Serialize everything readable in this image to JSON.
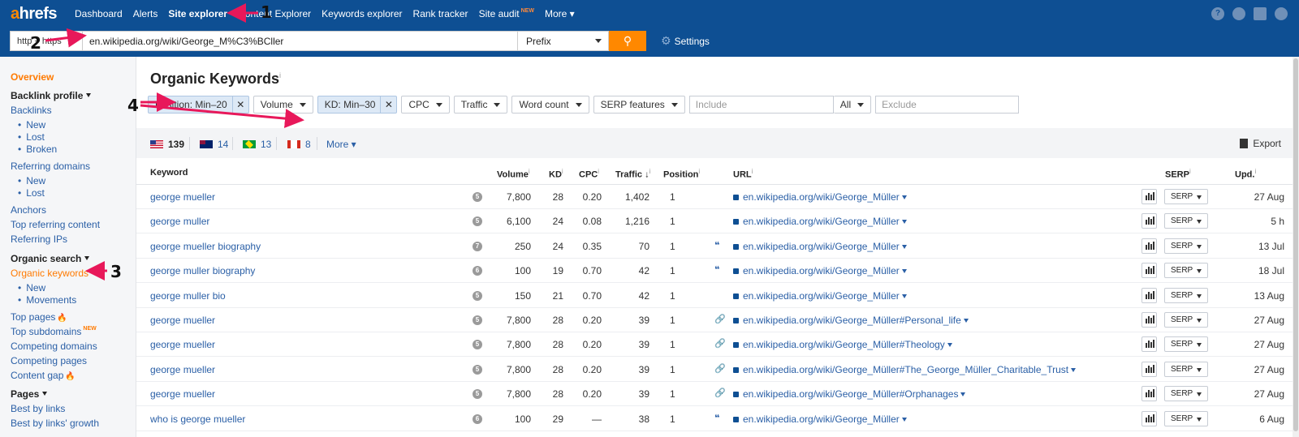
{
  "app": {
    "logo_a": "a",
    "logo_rest": "hrefs"
  },
  "nav": [
    {
      "label": "Dashboard",
      "active": false
    },
    {
      "label": "Alerts",
      "active": false
    },
    {
      "label": "Site explorer",
      "active": true
    },
    {
      "label": "Content Explorer",
      "active": false
    },
    {
      "label": "Keywords explorer",
      "active": false
    },
    {
      "label": "Rank tracker",
      "active": false
    },
    {
      "label": "Site audit",
      "active": false,
      "badge": "NEW"
    },
    {
      "label": "More",
      "active": false
    }
  ],
  "nav_display": [
    "Dashboard",
    "Alerts",
    "Site explorer",
    "Content Explorer",
    "Keywords explorer",
    "Rank tracker",
    "Site audit",
    "More"
  ],
  "search": {
    "protocol": "http + https",
    "url": "en.wikipedia.org/wiki/George_M%C3%BCller",
    "mode": "Prefix",
    "settings_label": "Settings"
  },
  "sidebar": {
    "overview": "Overview",
    "backlink_profile": "Backlink profile",
    "backlinks": "Backlinks",
    "backlinks_new": "New",
    "backlinks_lost": "Lost",
    "backlinks_broken": "Broken",
    "referring_domains": "Referring domains",
    "rd_new": "New",
    "rd_lost": "Lost",
    "anchors": "Anchors",
    "top_referring_content": "Top referring content",
    "referring_ips": "Referring IPs",
    "organic_search": "Organic search",
    "organic_keywords": "Organic keywords",
    "ok_new": "New",
    "ok_movements": "Movements",
    "top_pages": "Top pages",
    "top_subdomains": "Top subdomains",
    "top_subdomains_badge": "NEW",
    "competing_domains": "Competing domains",
    "competing_pages": "Competing pages",
    "content_gap": "Content gap",
    "pages": "Pages",
    "best_by_links": "Best by links",
    "best_by_links_growth": "Best by links' growth"
  },
  "main": {
    "title": "Organic Keywords",
    "title_info": "i",
    "filters": {
      "position": "Position: Min–20",
      "volume": "Volume",
      "kd": "KD: Min–30",
      "cpc": "CPC",
      "traffic": "Traffic",
      "word_count": "Word count",
      "serp_features": "SERP features",
      "include_placeholder": "Include",
      "all": "All",
      "exclude_placeholder": "Exclude"
    },
    "countries": [
      {
        "code": "us",
        "count": "139"
      },
      {
        "code": "au",
        "count": "14"
      },
      {
        "code": "br",
        "count": "13"
      },
      {
        "code": "ca",
        "count": "8"
      }
    ],
    "more_label": "More",
    "export_label": "Export"
  },
  "table": {
    "headers": {
      "keyword": "Keyword",
      "volume": "Volume",
      "kd": "KD",
      "cpc": "CPC",
      "traffic": "Traffic",
      "position": "Position",
      "url": "URL",
      "serp": "SERP",
      "upd": "Upd."
    },
    "serp_label": "SERP",
    "rows": [
      {
        "keyword": "george mueller",
        "sf": "5",
        "volume": "7,800",
        "kd": "28",
        "cpc": "0.20",
        "traffic": "1,402",
        "position": "1",
        "feature": "",
        "url": "en.wikipedia.org/wiki/George_Müller",
        "upd": "27 Aug"
      },
      {
        "keyword": "george muller",
        "sf": "5",
        "volume": "6,100",
        "kd": "24",
        "cpc": "0.08",
        "traffic": "1,216",
        "position": "1",
        "feature": "",
        "url": "en.wikipedia.org/wiki/George_Müller",
        "upd": "5 h"
      },
      {
        "keyword": "george mueller biography",
        "sf": "7",
        "volume": "250",
        "kd": "24",
        "cpc": "0.35",
        "traffic": "70",
        "position": "1",
        "feature": "quote",
        "url": "en.wikipedia.org/wiki/George_Müller",
        "upd": "13 Jul"
      },
      {
        "keyword": "george muller biography",
        "sf": "6",
        "volume": "100",
        "kd": "19",
        "cpc": "0.70",
        "traffic": "42",
        "position": "1",
        "feature": "quote",
        "url": "en.wikipedia.org/wiki/George_Müller",
        "upd": "18 Jul"
      },
      {
        "keyword": "george muller bio",
        "sf": "5",
        "volume": "150",
        "kd": "21",
        "cpc": "0.70",
        "traffic": "42",
        "position": "1",
        "feature": "",
        "url": "en.wikipedia.org/wiki/George_Müller",
        "upd": "13 Aug"
      },
      {
        "keyword": "george mueller",
        "sf": "5",
        "volume": "7,800",
        "kd": "28",
        "cpc": "0.20",
        "traffic": "39",
        "position": "1",
        "feature": "link",
        "url": "en.wikipedia.org/wiki/George_Müller#Personal_life",
        "upd": "27 Aug"
      },
      {
        "keyword": "george mueller",
        "sf": "5",
        "volume": "7,800",
        "kd": "28",
        "cpc": "0.20",
        "traffic": "39",
        "position": "1",
        "feature": "link",
        "url": "en.wikipedia.org/wiki/George_Müller#Theology",
        "upd": "27 Aug"
      },
      {
        "keyword": "george mueller",
        "sf": "5",
        "volume": "7,800",
        "kd": "28",
        "cpc": "0.20",
        "traffic": "39",
        "position": "1",
        "feature": "link",
        "url": "en.wikipedia.org/wiki/George_Müller#The_George_Müller_Charitable_Trust",
        "upd": "27 Aug"
      },
      {
        "keyword": "george mueller",
        "sf": "5",
        "volume": "7,800",
        "kd": "28",
        "cpc": "0.20",
        "traffic": "39",
        "position": "1",
        "feature": "link",
        "url": "en.wikipedia.org/wiki/George_Müller#Orphanages",
        "upd": "27 Aug"
      },
      {
        "keyword": "who is george mueller",
        "sf": "6",
        "volume": "100",
        "kd": "29",
        "cpc": "—",
        "traffic": "38",
        "position": "1",
        "feature": "quote",
        "url": "en.wikipedia.org/wiki/George_Müller",
        "upd": "6 Aug"
      }
    ]
  },
  "annotations": [
    "1",
    "2",
    "3",
    "4"
  ],
  "colors": {
    "topbar": "#0e4f93",
    "accent": "#ff8800",
    "link": "#2a5fa6",
    "arrow": "#e8185a"
  }
}
